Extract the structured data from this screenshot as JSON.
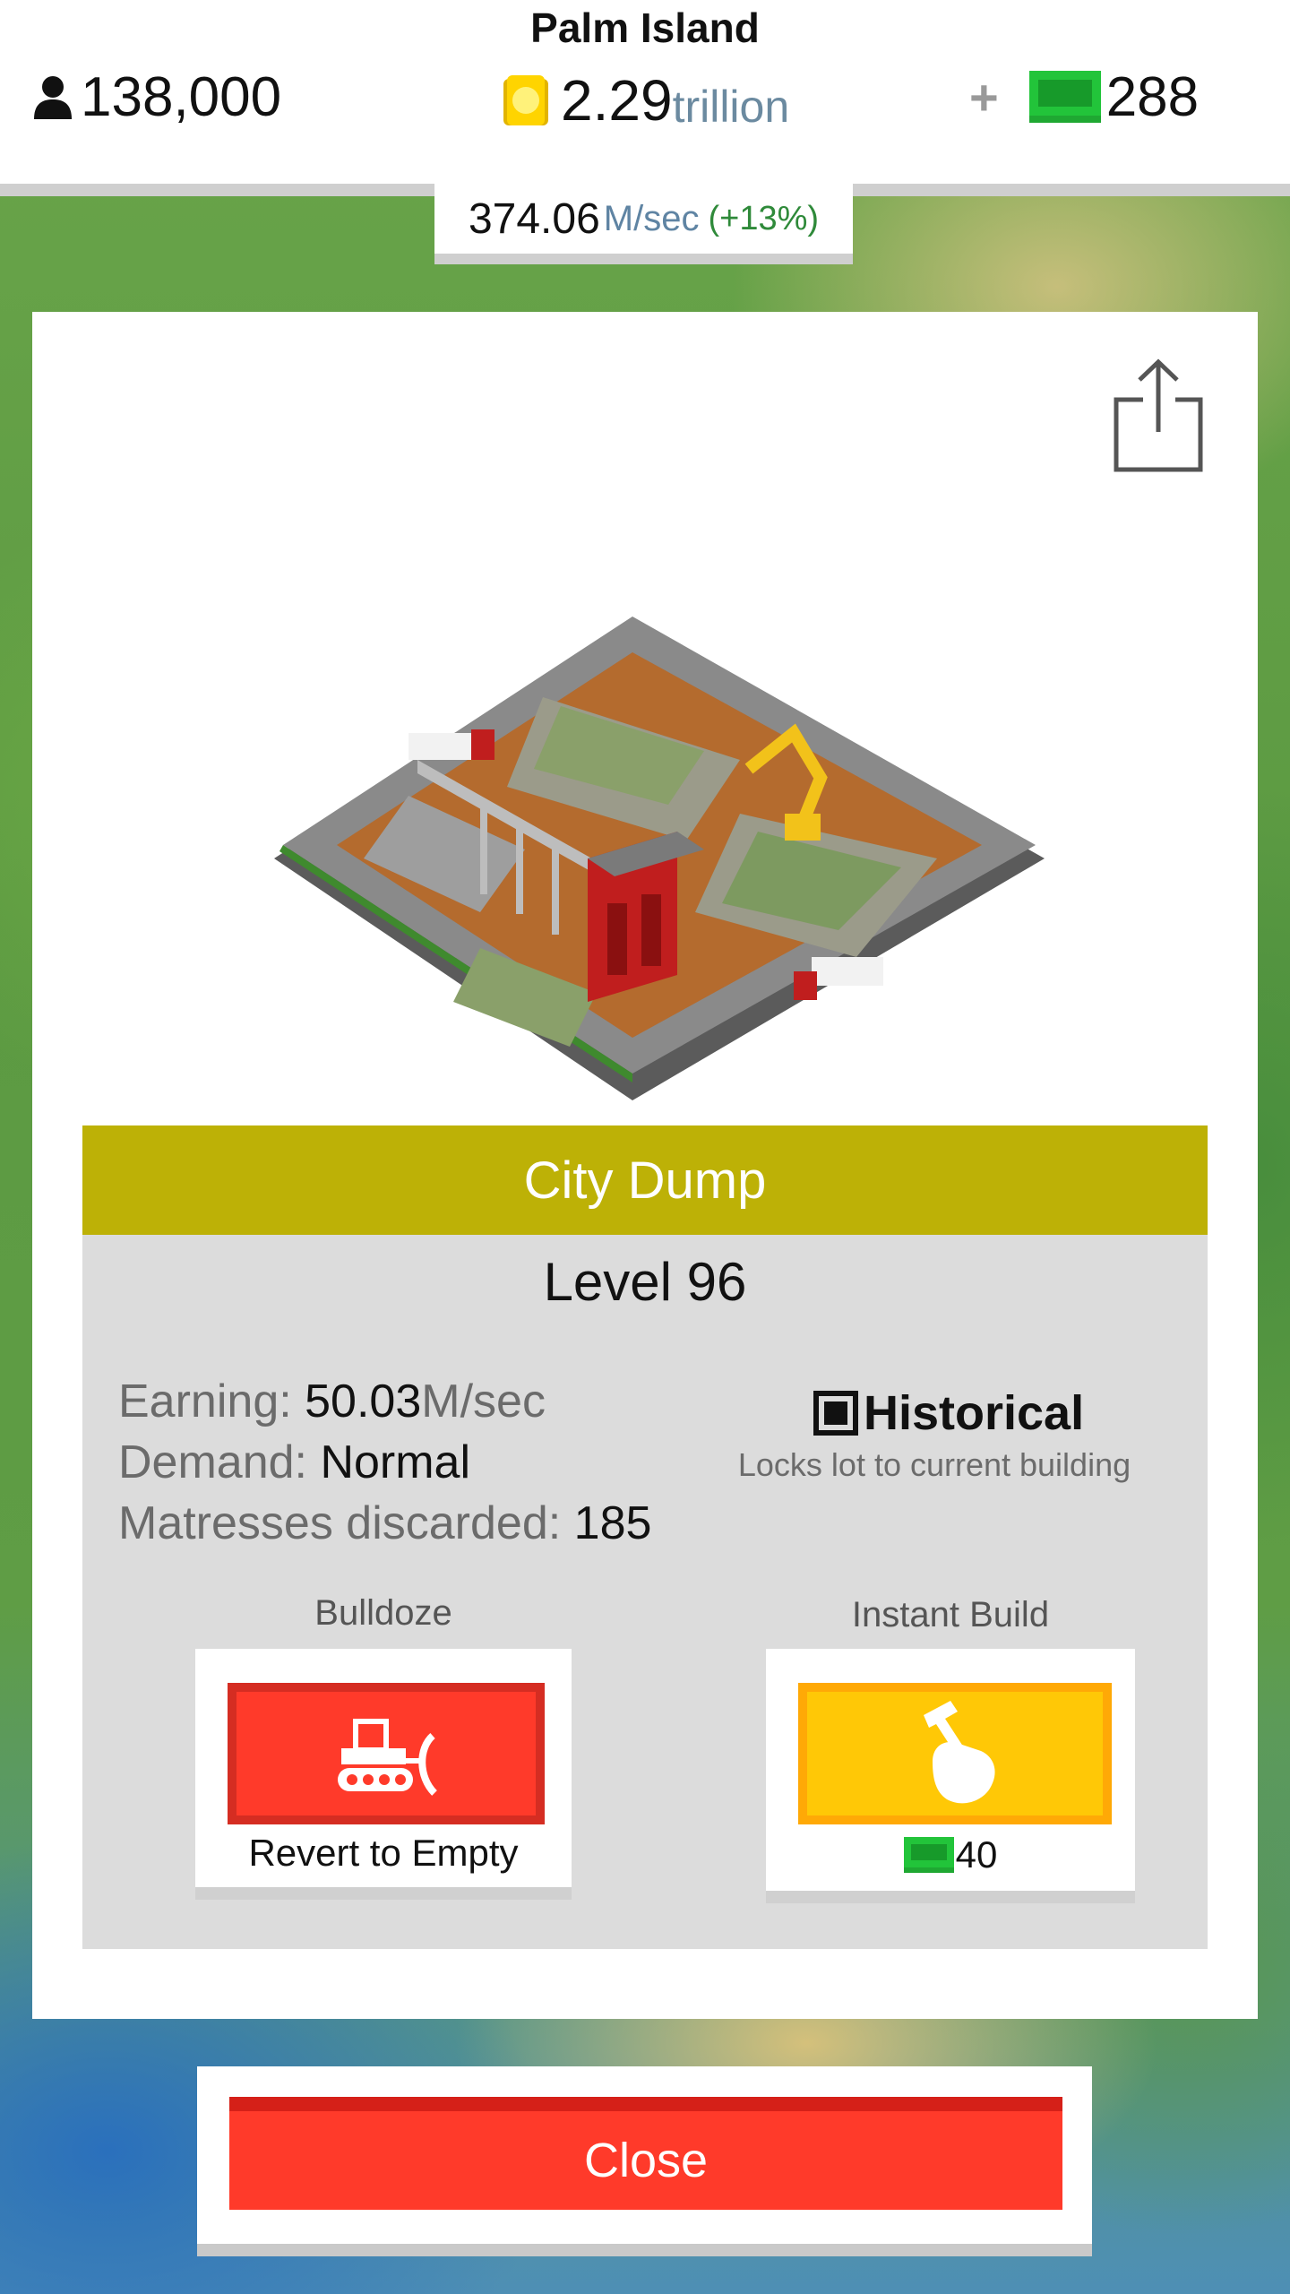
{
  "header": {
    "island_name": "Palm Island",
    "population": "138,000",
    "coins_value": "2.29",
    "coins_unit": "trillion",
    "gems_plus": "+",
    "gems_value": "288",
    "income_value": "374.06",
    "income_unit": "M/sec",
    "income_change": "(+13%)"
  },
  "building": {
    "name": "City Dump",
    "level": "Level 96",
    "earning_label": "Earning: ",
    "earning_value": "50.03",
    "earning_unit": "M/sec",
    "demand_label": "Demand: ",
    "demand_value": "Normal",
    "custom_stat_label": "Matresses discarded: ",
    "custom_stat_value": "185"
  },
  "historical": {
    "label": "Historical",
    "description": "Locks lot to current building"
  },
  "actions": {
    "bulldoze_title": "Bulldoze",
    "bulldoze_caption": "Revert to Empty",
    "instant_title": "Instant Build",
    "instant_cost": "40"
  },
  "footer": {
    "close_label": "Close"
  },
  "colors": {
    "title_bar": "#bdb106",
    "bulldoze_red": "#ff3a2a",
    "instant_yellow": "#ffc806",
    "gem_green": "#22c43a",
    "coin_gold": "#ffd400"
  },
  "icons": {
    "population": "person-icon",
    "coins": "coin-icon",
    "gems": "green-bill-icon",
    "share": "share-icon",
    "bulldoze": "bulldozer-icon",
    "instant": "hammer-hand-icon"
  }
}
